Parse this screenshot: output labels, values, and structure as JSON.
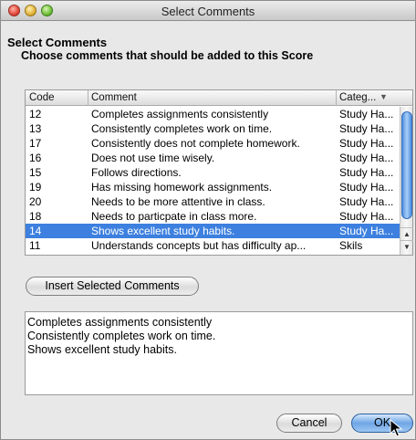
{
  "window": {
    "title": "Select Comments"
  },
  "header": {
    "title": "Select Comments",
    "subtitle": "Choose comments that should be added to this Score"
  },
  "list": {
    "columns": {
      "code": "Code",
      "comment": "Comment",
      "category": "Categ..."
    },
    "sort_indicator": "▼",
    "rows": [
      {
        "code": "12",
        "comment": "Completes assignments consistently",
        "category": "Study Ha..."
      },
      {
        "code": "13",
        "comment": "Consistently completes work on time.",
        "category": "Study Ha..."
      },
      {
        "code": "17",
        "comment": "Consistently does not complete homework.",
        "category": "Study Ha..."
      },
      {
        "code": "16",
        "comment": "Does not use time wisely.",
        "category": "Study Ha..."
      },
      {
        "code": "15",
        "comment": "Follows directions.",
        "category": "Study Ha..."
      },
      {
        "code": "19",
        "comment": "Has missing homework assignments.",
        "category": "Study Ha..."
      },
      {
        "code": "20",
        "comment": "Needs to be more attentive in class.",
        "category": "Study Ha..."
      },
      {
        "code": "18",
        "comment": "Needs to particpate in class more.",
        "category": "Study Ha..."
      },
      {
        "code": "14",
        "comment": "Shows excellent study habits.",
        "category": "Study Ha..."
      },
      {
        "code": "11",
        "comment": "Understands concepts but has difficulty ap...",
        "category": "Skils"
      }
    ],
    "selected_index": 8
  },
  "insert_button": {
    "label": "Insert Selected Comments"
  },
  "selected_text": {
    "lines": [
      "Completes assignments consistently",
      "Consistently completes work on time.",
      "Shows excellent study habits."
    ]
  },
  "buttons": {
    "cancel": "Cancel",
    "ok": "OK"
  },
  "icons": {
    "close": "close-icon",
    "minimize": "minimize-icon",
    "zoom": "zoom-icon",
    "sort": "sort-descending-icon",
    "scroll_up": "arrow-up-icon",
    "scroll_down": "arrow-down-icon",
    "cursor": "pointer-cursor-icon"
  },
  "colors": {
    "selection": "#3d80df",
    "default_button": "#6fa6e6"
  }
}
